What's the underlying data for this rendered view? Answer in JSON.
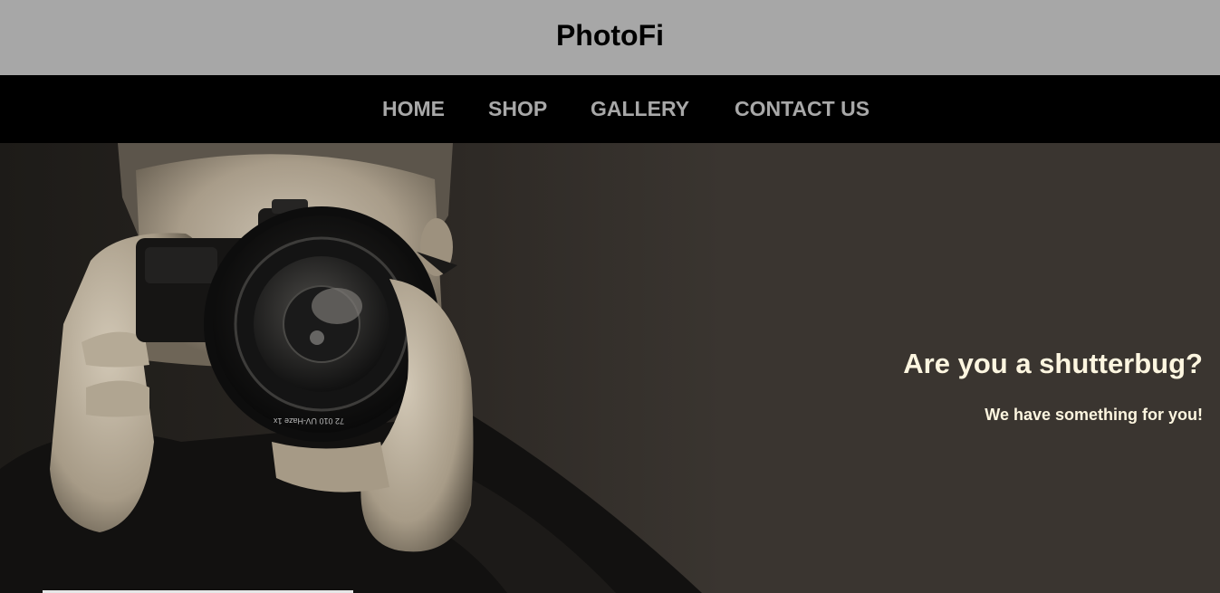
{
  "header": {
    "title": "PhotoFi"
  },
  "nav": {
    "items": [
      {
        "label": "HOME"
      },
      {
        "label": "SHOP"
      },
      {
        "label": "GALLERY"
      },
      {
        "label": "CONTACT US"
      }
    ]
  },
  "hero": {
    "heading": "Are you a shutterbug?",
    "subheading": "We have something for you!",
    "image": "photographer-with-camera",
    "background_color": "#3a3530"
  },
  "colors": {
    "header_bg": "#a7a7a7",
    "nav_bg": "#000000",
    "nav_text": "#a8a8a8",
    "hero_text": "#fdf6e0"
  }
}
